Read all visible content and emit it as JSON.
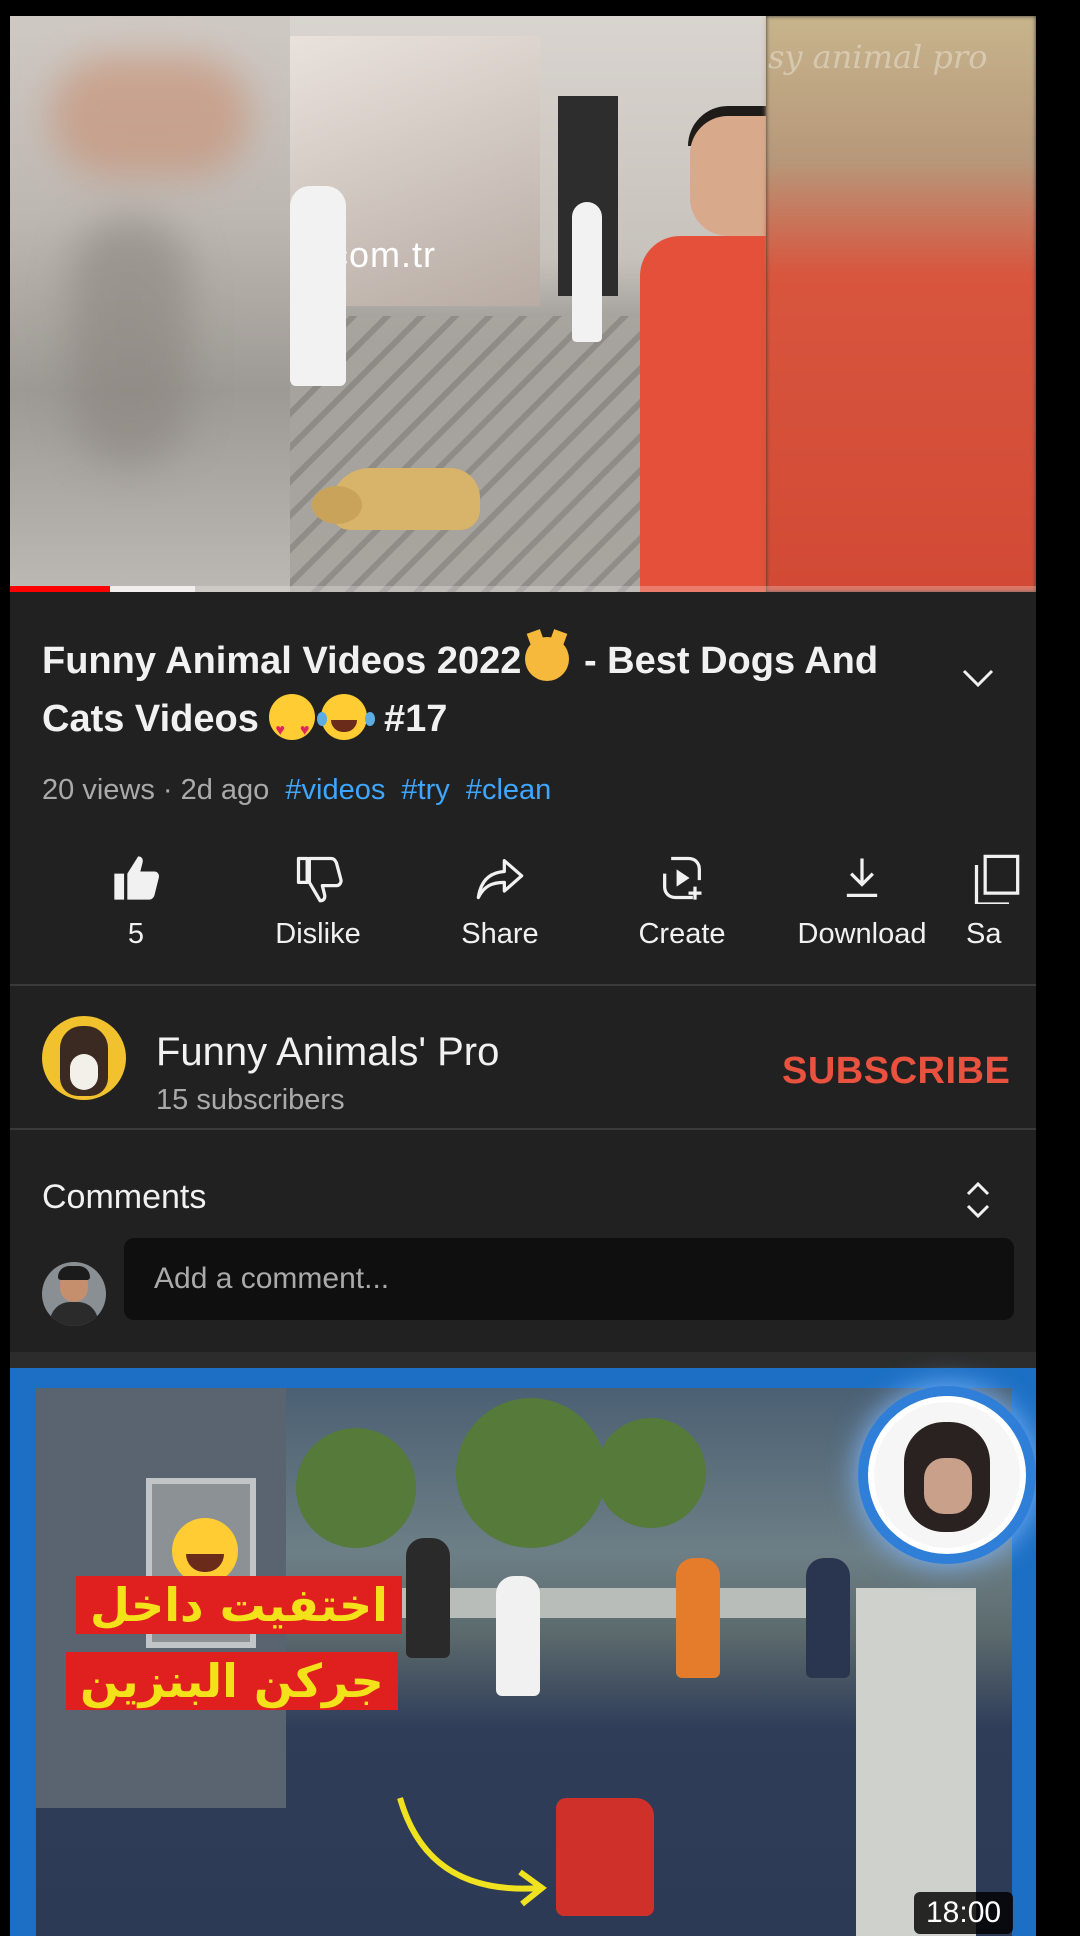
{
  "player": {
    "watermark": "sy animal pro",
    "scene_text": "com.tr",
    "progress": {
      "played_fraction": 0.097,
      "buffered_fraction": 0.18
    }
  },
  "video": {
    "title_part1": "Funny Animal Videos 2022",
    "title_part2": " - Best Dogs And Cats Videos ",
    "title_part3": " #17",
    "views": "20 views",
    "age": "2d ago",
    "hashtags": [
      "#videos",
      "#try",
      "#clean"
    ]
  },
  "actions": [
    {
      "label": "5",
      "icon": "thumbs-up-icon"
    },
    {
      "label": "Dislike",
      "icon": "thumbs-down-icon"
    },
    {
      "label": "Share",
      "icon": "share-icon"
    },
    {
      "label": "Create",
      "icon": "create-icon"
    },
    {
      "label": "Download",
      "icon": "download-icon"
    },
    {
      "label": "Sa",
      "icon": "save-icon"
    }
  ],
  "channel": {
    "name": "Funny Animals' Pro",
    "subscribers": "15 subscribers",
    "subscribe_label": "SUBSCRIBE"
  },
  "comments": {
    "title": "Comments",
    "placeholder": "Add a comment..."
  },
  "next_video": {
    "overlay_line1": "اختفيت داخل",
    "overlay_line2": "جركن البنزين",
    "duration": "18:00"
  },
  "colors": {
    "background": "#212121",
    "accent_link": "#3ea6ff",
    "subscribe": "#e8523f",
    "progress": "#ff0000"
  }
}
